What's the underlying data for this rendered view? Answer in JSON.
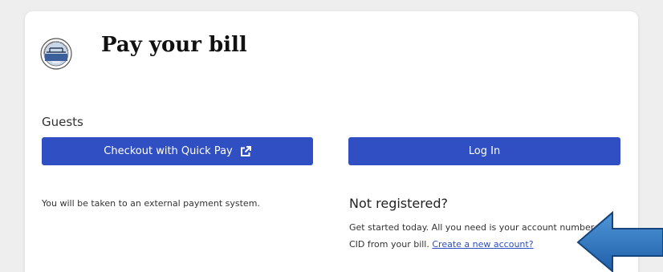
{
  "header": {
    "title": "Pay your bill",
    "seal_text": "DEPARTMENT OF UTILITIES"
  },
  "guests": {
    "label": "Guests",
    "quick_pay_button": "Checkout with Quick Pay",
    "note": "You will be taken to an external payment system."
  },
  "login": {
    "button": "Log In"
  },
  "registration": {
    "heading": "Not registered?",
    "text": "Get started today. All you need is your account number and CID from your bill.",
    "link": "Create a new account?"
  },
  "colors": {
    "primary": "#2f4fc3",
    "arrow": "#2a74c4"
  },
  "icons": {
    "quick_pay": "external-link-icon",
    "annotation": "arrow-left-icon"
  }
}
